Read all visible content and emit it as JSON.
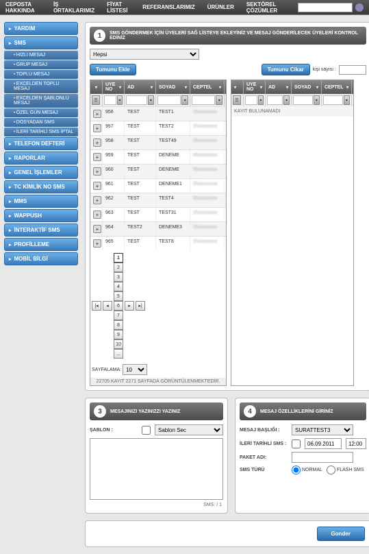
{
  "topnav": {
    "items": [
      "CEPOSTA HAKKINDA",
      "İŞ ORTAKLARIMIZ",
      "FİYAT LİSTESİ",
      "REFERANSLARIMIZ",
      "ÜRÜNLER",
      "SEKTÖREL ÇÖZÜMLER"
    ]
  },
  "sidebar": {
    "groups": [
      {
        "label": "YARDIM",
        "items": []
      },
      {
        "label": "SMS",
        "items": [
          "HIZLI MESAJ",
          "GRUP MESAJ",
          "TOPLU MESAJ",
          "EXCELDEN TOPLU MESAJ",
          "EXCELDEN ŞABLONLU MESAJ",
          "ÖZEL GÜN MESAJ",
          "DOSYADAN SMS",
          "İLERİ TARİHLİ SMS İPTAL"
        ]
      },
      {
        "label": "TELEFON DEFTERİ",
        "items": []
      },
      {
        "label": "RAPORLAR",
        "items": []
      },
      {
        "label": "GENEL İŞLEMLER",
        "items": []
      },
      {
        "label": "TC KİMLİK NO SMS",
        "items": []
      },
      {
        "label": "MMS",
        "items": []
      },
      {
        "label": "WAPPUSH",
        "items": []
      },
      {
        "label": "İNTERAKTİF SMS",
        "items": []
      },
      {
        "label": "PROFİLLEME",
        "items": []
      },
      {
        "label": "MOBİL BİLGİ",
        "items": []
      }
    ]
  },
  "step1": {
    "title": "SMS GÖNDERMEK İÇİN ÜYELERİ SAĞ LİSTEYE EKLEYİNİZ VE MESAJ GÖNDERİLECEK ÜYELERİ KONTROL EDİNİZ",
    "dropdown": "Hepsi",
    "btn_add": "Tumunu Ekle",
    "btn_remove": "Tumunu Cikar",
    "kisi_label": "kişi sayısı :",
    "cols": [
      "",
      "UYE NO",
      "AD",
      "SOYAD",
      "CEPTEL"
    ],
    "rows": [
      {
        "no": "956",
        "ad": "TEST",
        "soyad": "TEST1"
      },
      {
        "no": "957",
        "ad": "TEST",
        "soyad": "TEST2"
      },
      {
        "no": "958",
        "ad": "TEST",
        "soyad": "TEST49"
      },
      {
        "no": "959",
        "ad": "TEST",
        "soyad": "DENEME"
      },
      {
        "no": "960",
        "ad": "TEST",
        "soyad": "DENEME"
      },
      {
        "no": "961",
        "ad": "TEST",
        "soyad": "DENEME1"
      },
      {
        "no": "962",
        "ad": "TEST",
        "soyad": "TEST4"
      },
      {
        "no": "963",
        "ad": "TEST",
        "soyad": "TEST31"
      },
      {
        "no": "964",
        "ad": "TEST2",
        "soyad": "DENEME3"
      },
      {
        "no": "965",
        "ad": "TEST",
        "soyad": "TEST8"
      }
    ],
    "nodata": "KAYIT BULUNAMADI",
    "pages": [
      "1",
      "2",
      "3",
      "4",
      "5",
      "6",
      "7",
      "8",
      "9",
      "10",
      "..."
    ],
    "page_label": "SAYFALAMA:",
    "page_size": "10",
    "footer": "22705 KAYIT 2271 SAYFADA GÖRÜNTÜLENMEKTEDİR."
  },
  "step3": {
    "title": "MESAJINIZI YAZINIZZI YAZINIZ",
    "sablon_label": "ŞABLON :",
    "sablon_value": "Sablon Sec",
    "sms_count": "SMS:        / 1"
  },
  "step4": {
    "title": "MESAJ ÖZELLİKLERİNİ GİRİNİZ",
    "baslik_label": "MESAJ BAŞLIĞI :",
    "baslik_value": "SURATTEST3",
    "ileri_label": "İLERİ TARİHLİ SMS :",
    "date": "06.09.2011",
    "time": "12:00",
    "paket_label": "PAKET ADI:",
    "turu_label": "SMS TÜRÜ",
    "normal": "NORMAL",
    "flash": "FLASH SMS"
  },
  "send": "Gonder"
}
